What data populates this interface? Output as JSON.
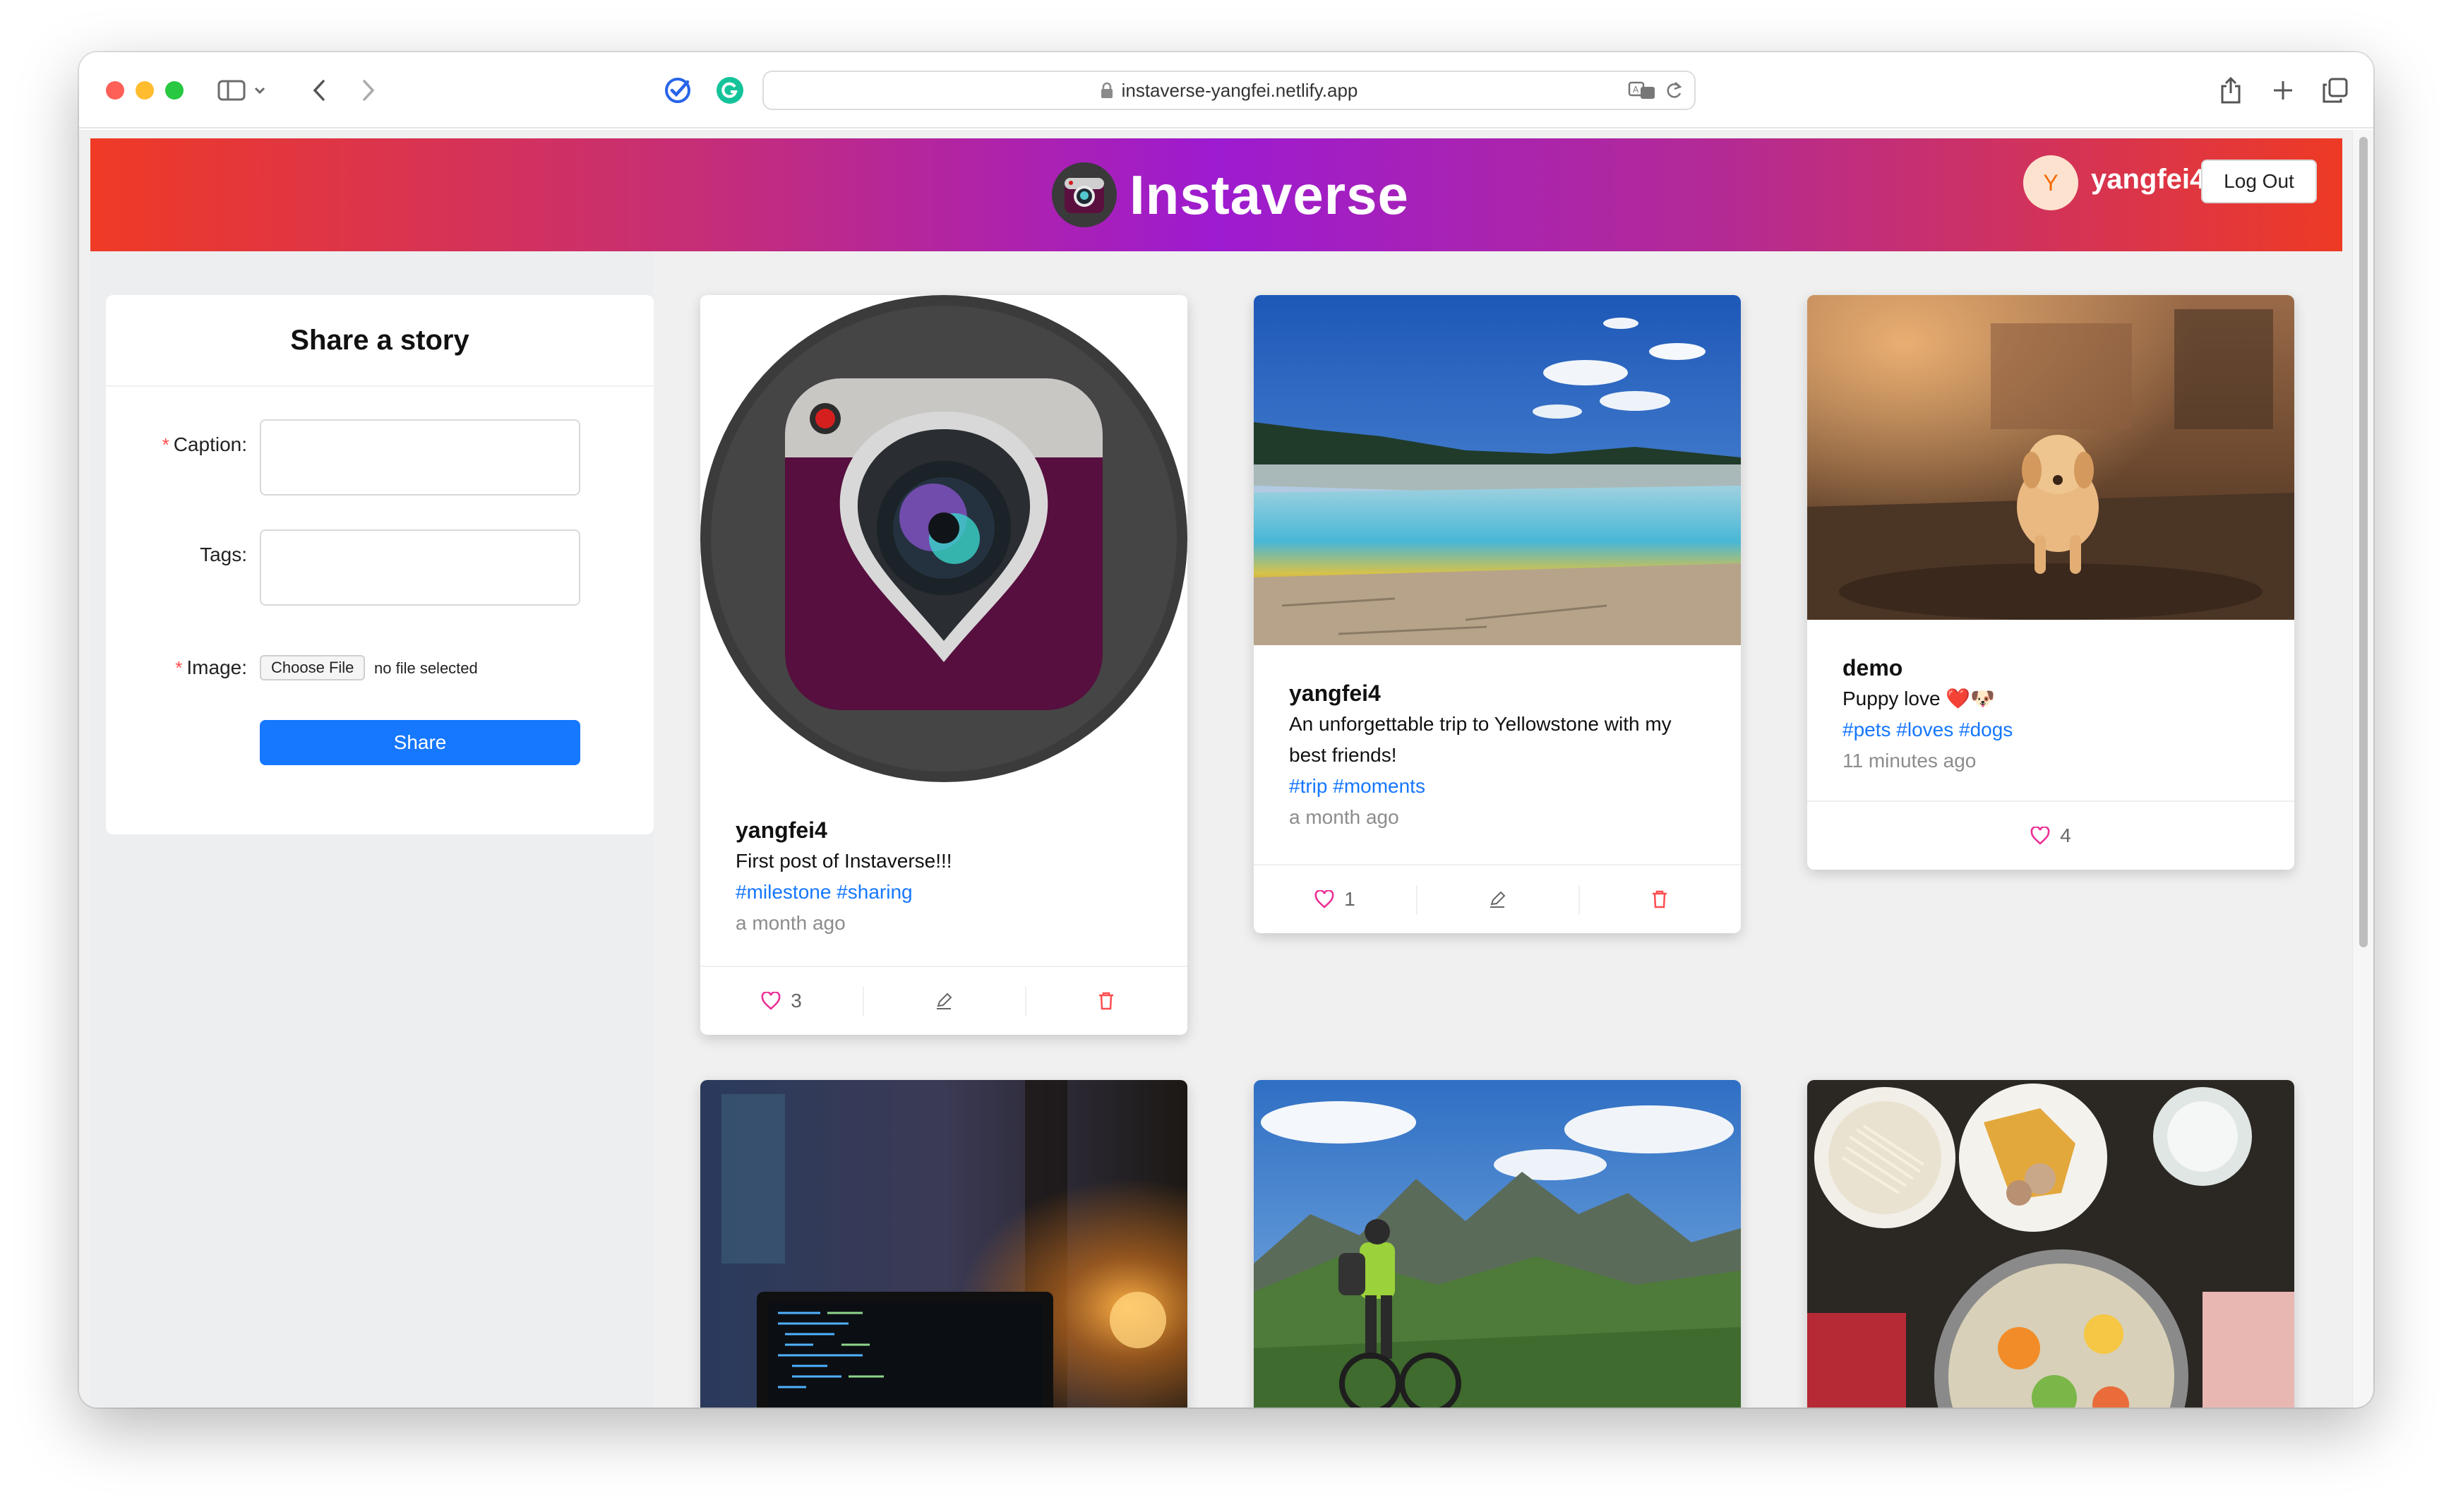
{
  "browser": {
    "url": "instaverse-yangfei.netlify.app"
  },
  "header": {
    "title": "Instaverse",
    "avatar_initial": "Y",
    "username": "yangfei4",
    "logout_label": "Log Out"
  },
  "form": {
    "title": "Share a story",
    "caption_label": "Caption",
    "tags_label": "Tags",
    "image_label": "Image",
    "required_mark": "*",
    "colon": ":",
    "file_button": "Choose File",
    "file_status": "no file selected",
    "share_label": "Share"
  },
  "posts": [
    {
      "user": "yangfei4",
      "caption": "First post of Instaverse!!!",
      "tags": "#milestone #sharing",
      "time": "a month ago",
      "likes": "3"
    },
    {
      "user": "yangfei4",
      "caption": "An unforgettable trip to Yellowstone with my best friends!",
      "tags": "#trip #moments",
      "time": "a month ago",
      "likes": "1"
    },
    {
      "user": "demo",
      "caption": "Puppy love ❤️🐶",
      "tags": "#pets #loves #dogs",
      "time": "11 minutes ago",
      "likes": "4"
    }
  ],
  "colors": {
    "accent": "#1677ff",
    "danger": "#ff4d4f",
    "like": "#eb2f96",
    "header_gradient": [
      "#ef3a25",
      "#9d1bd0",
      "#ee3a24"
    ]
  },
  "icons": {
    "like": "heart-icon",
    "edit": "pencil-icon",
    "delete": "trash-icon"
  }
}
